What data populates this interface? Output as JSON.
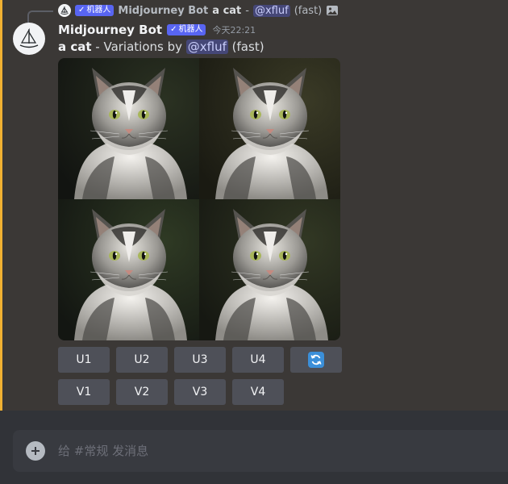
{
  "reply": {
    "tag": "机器人",
    "author": "Midjourney Bot",
    "prompt": "a cat",
    "separator": " - ",
    "mention": "@xfluf",
    "speed": "(fast)"
  },
  "message": {
    "author": "Midjourney Bot",
    "tag": "机器人",
    "timestamp": "今天22:21",
    "prompt": "a cat",
    "text": " - Variations by ",
    "mention": "@xfluf",
    "speed": " (fast)"
  },
  "image": {
    "tiles": [
      "cat-variation-1",
      "cat-variation-2",
      "cat-variation-3",
      "cat-variation-4"
    ]
  },
  "buttons": {
    "upscale": [
      "U1",
      "U2",
      "U3",
      "U4"
    ],
    "reroll_icon": "refresh-icon",
    "variation": [
      "V1",
      "V2",
      "V3",
      "V4"
    ]
  },
  "composer": {
    "placeholder": "给 #常规 发消息",
    "add_icon": "plus-circle-icon"
  },
  "colors": {
    "mention_accent": "#5865f2",
    "highlight_bar": "#f0b132",
    "reroll_blue": "#3b8fd9",
    "button_bg": "#4e5058"
  }
}
